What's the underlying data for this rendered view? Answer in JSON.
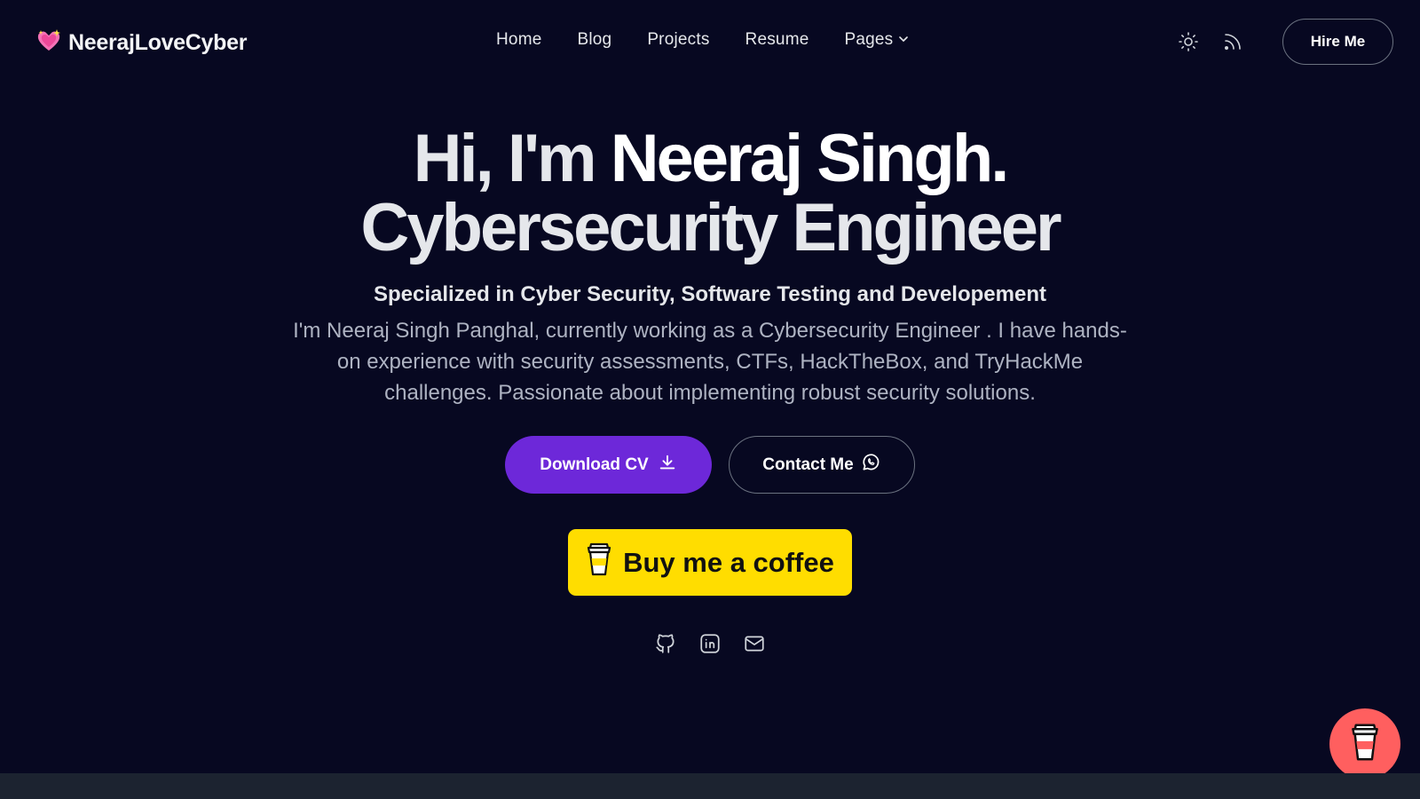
{
  "nav": {
    "brand": "NeerajLoveCyber",
    "links": [
      "Home",
      "Blog",
      "Projects",
      "Resume",
      "Pages"
    ],
    "hire_label": "Hire Me",
    "icons": [
      "sparkle-heart-icon",
      "sun-icon",
      "rss-icon",
      "chevron-down-icon"
    ]
  },
  "hero": {
    "title_prefix": "Hi, I'm ",
    "title_name": "Neeraj Singh.",
    "title_line2": "Cybersecurity Engineer",
    "subtitle": "Specialized in Cyber Security, Software Testing and Developement",
    "description": "I'm Neeraj Singh Panghal, currently working as a Cybersecurity Engineer . I have hands-on experience with security assessments, CTFs, HackTheBox, and TryHackMe challenges. Passionate about implementing robust security solutions."
  },
  "buttons": {
    "download_cv": "Download CV",
    "contact": "Contact Me",
    "coffee": "Buy me a coffee"
  },
  "socials": [
    "github-icon",
    "linkedin-icon",
    "mail-icon"
  ],
  "colors": {
    "background": "#070821",
    "primary": "#6d28d9",
    "coffee": "#ffdd00",
    "fab": "#ff5f5f"
  }
}
